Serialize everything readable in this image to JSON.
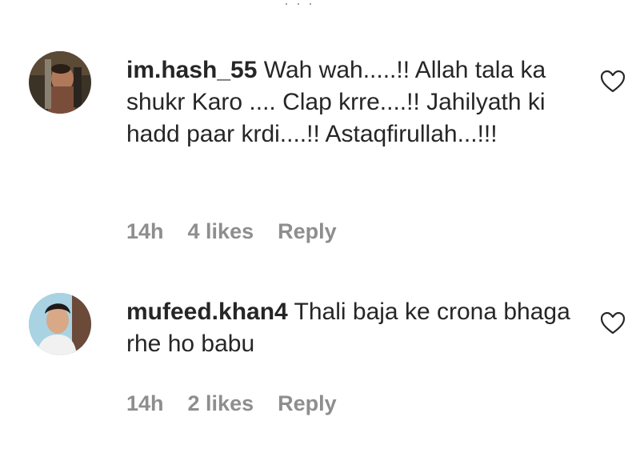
{
  "top_ellipsis": "· · ·",
  "comments": [
    {
      "username": "im.hash_55",
      "text": "Wah wah.....!! Allah tala ka shukr Karo .... Clap krre....!! Jahilyath ki hadd paar krdi....!! Astaqfirullah...!!!",
      "time": "14h",
      "likes": "4 likes",
      "reply": "Reply",
      "like_icon": "heart-outline-icon"
    },
    {
      "username": "mufeed.khan4",
      "text": "Thali baja ke crona bhaga rhe ho babu",
      "time": "14h",
      "likes": "2 likes",
      "reply": "Reply",
      "like_icon": "heart-outline-icon"
    }
  ],
  "colors": {
    "text": "#262626",
    "meta": "#8e8e8e",
    "background": "#ffffff"
  }
}
